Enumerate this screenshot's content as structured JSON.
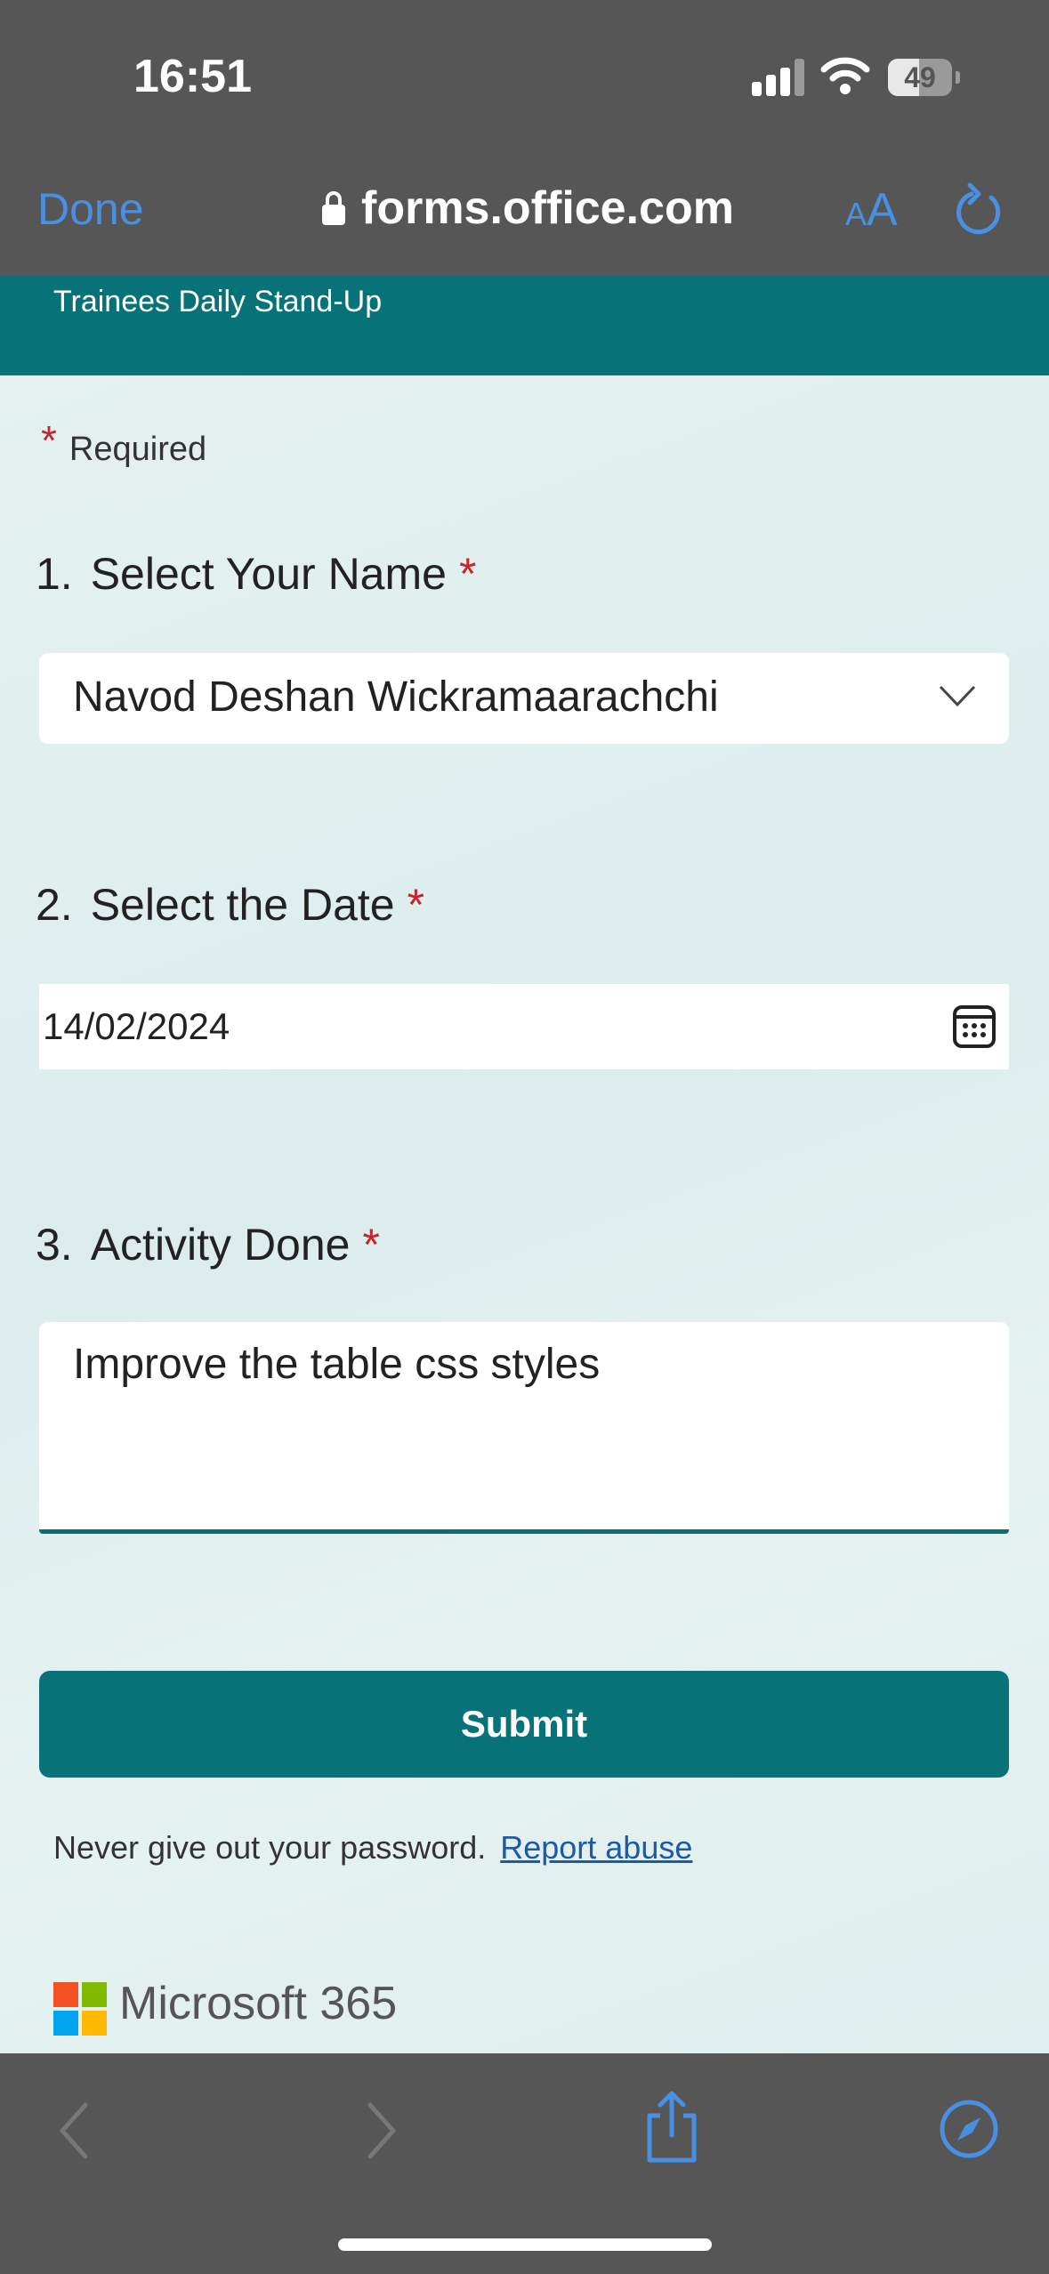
{
  "status_bar": {
    "time": "16:51",
    "battery": "49",
    "battery_level": 0.49
  },
  "browser": {
    "done_label": "Done",
    "url": "forms.office.com",
    "text_size_small": "A",
    "text_size_big": "A"
  },
  "form": {
    "title": "Trainees Daily Stand-Up",
    "required_label": "Required",
    "required_marker": "*",
    "questions": [
      {
        "number": "1.",
        "title": "Select Your Name",
        "value": "Navod Deshan Wickramaarachchi"
      },
      {
        "number": "2.",
        "title": "Select the Date",
        "value": "14/02/2024"
      },
      {
        "number": "3.",
        "title": "Activity Done",
        "value": "Improve the table css styles"
      }
    ],
    "submit_label": "Submit",
    "footer_text": "Never give out your password.",
    "report_abuse": "Report abuse",
    "brand": "Microsoft 365"
  },
  "colors": {
    "teal": "#077378",
    "link_blue": "#4a90e2",
    "required_red": "#c4262e"
  }
}
